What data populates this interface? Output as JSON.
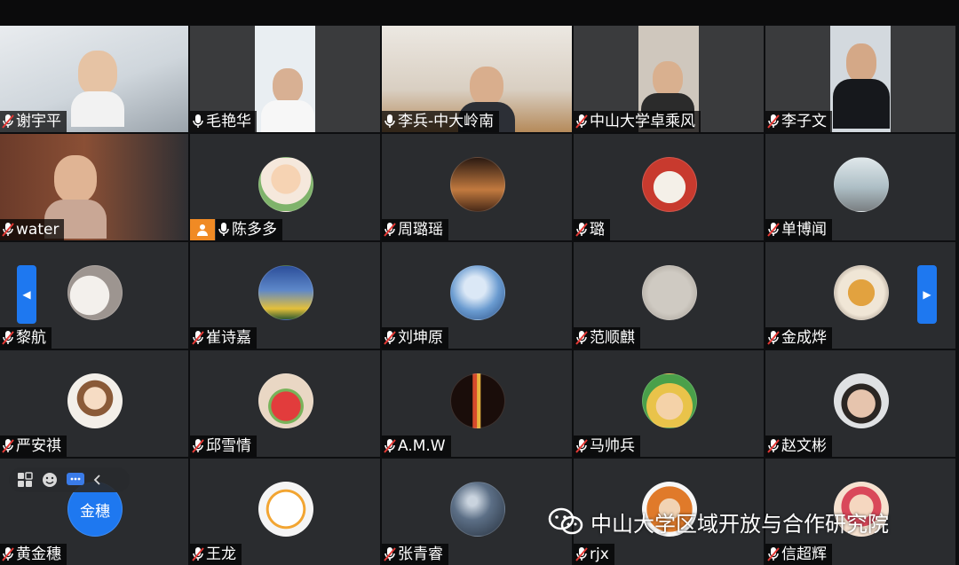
{
  "participants": [
    {
      "name": "谢宇平",
      "video": true
    },
    {
      "name": "毛艳华",
      "video": true
    },
    {
      "name": "李兵-中大岭南",
      "video": true
    },
    {
      "name": "中山大学卓乘风",
      "video": true
    },
    {
      "name": "李子文",
      "video": true
    },
    {
      "name": "water",
      "video": true
    },
    {
      "name": "陈多多",
      "host": true
    },
    {
      "name": "周璐瑶"
    },
    {
      "name": "璐"
    },
    {
      "name": "单博闻"
    },
    {
      "name": "黎航"
    },
    {
      "name": "崔诗嘉"
    },
    {
      "name": "刘坤原"
    },
    {
      "name": "范顺麒"
    },
    {
      "name": "金成烨"
    },
    {
      "name": "严安祺"
    },
    {
      "name": "邱雪情"
    },
    {
      "name": "A.M.W"
    },
    {
      "name": "马帅兵"
    },
    {
      "name": "赵文彬"
    },
    {
      "name": "黄金穗",
      "avatar_text": "金穗"
    },
    {
      "name": "王龙"
    },
    {
      "name": "张青睿"
    },
    {
      "name": "rjx"
    },
    {
      "name": "信超辉"
    }
  ],
  "watermark": {
    "text": "中山大学区域开放与合作研究院"
  },
  "nav": {
    "prev_icon": "◀",
    "next_icon": "▶"
  },
  "toolbar": {
    "icons": [
      "grid-icon",
      "emoji-icon",
      "chat-icon",
      "chevron-left-icon"
    ]
  },
  "colors": {
    "accent": "#1e78f0",
    "host_badge": "#f08a24",
    "tile_bg": "#2a2c2f",
    "background": "#0d0e10"
  }
}
